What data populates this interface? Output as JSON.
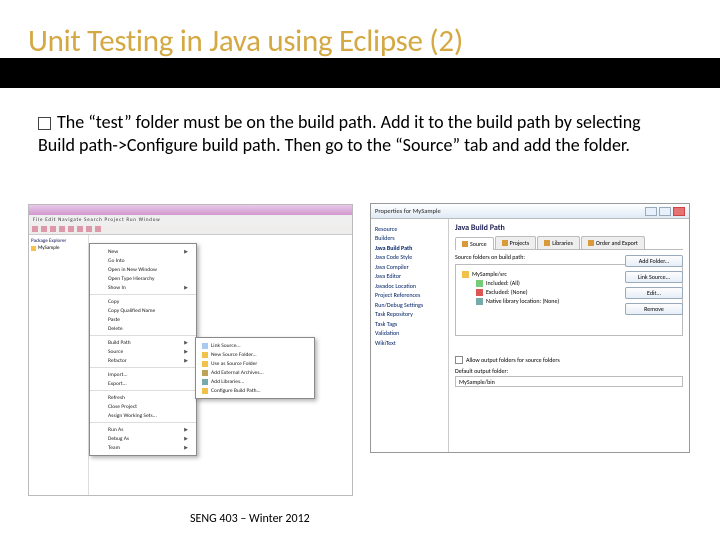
{
  "title": "Unit Testing in Java using Eclipse (2)",
  "body": "The “test” folder must be on the build path. Add it to the build path by selecting Build path->Configure build path. Then go to the “Source” tab and add the folder.",
  "footer": "SENG 403 – Winter 2012",
  "eclipse": {
    "menubar": "File  Edit  Navigate  Search  Project  Run  Window",
    "pkg_explorer_title": "Package Explorer",
    "projects": [
      "MySample"
    ],
    "context_menu": {
      "items": [
        {
          "label": "New",
          "arrow": true
        },
        {
          "label": "Go Into"
        },
        {
          "label": "Open in New Window"
        },
        {
          "label": "Open Type Hierarchy"
        },
        {
          "label": "Show In",
          "arrow": true
        },
        {
          "hr": true
        },
        {
          "label": "Copy"
        },
        {
          "label": "Copy Qualified Name"
        },
        {
          "label": "Paste"
        },
        {
          "label": "Delete"
        },
        {
          "hr": true
        },
        {
          "label": "Build Path",
          "arrow": true
        },
        {
          "label": "Source",
          "arrow": true
        },
        {
          "label": "Refactor",
          "arrow": true
        },
        {
          "hr": true
        },
        {
          "label": "Import..."
        },
        {
          "label": "Export..."
        },
        {
          "hr": true
        },
        {
          "label": "Refresh"
        },
        {
          "label": "Close Project"
        },
        {
          "label": "Assign Working Sets..."
        },
        {
          "hr": true
        },
        {
          "label": "Run As",
          "arrow": true
        },
        {
          "label": "Debug As",
          "arrow": true
        },
        {
          "label": "Team",
          "arrow": true
        }
      ],
      "submenu": [
        {
          "label": "Link Source...",
          "ic": "ic-src"
        },
        {
          "label": "New Source Folder...",
          "ic": "ic-folder"
        },
        {
          "label": "Use as Source Folder",
          "ic": "ic-folder"
        },
        {
          "label": "Add External Archives...",
          "ic": "ic-jar"
        },
        {
          "label": "Add Libraries...",
          "ic": "ic-lib"
        },
        {
          "label": "Configure Build Path...",
          "ic": "ic-folder"
        }
      ]
    }
  },
  "props": {
    "title": "Properties for MySample",
    "nav": [
      "Resource",
      "Builders",
      "Java Build Path",
      "Java Code Style",
      "Java Compiler",
      "Java Editor",
      "Javadoc Location",
      "Project References",
      "Run/Debug Settings",
      "Task Repository",
      "Task Tags",
      "Validation",
      "WikiText"
    ],
    "nav_selected": "Java Build Path",
    "heading": "Java Build Path",
    "tabs": [
      "Source",
      "Projects",
      "Libraries",
      "Order and Export"
    ],
    "active_tab": "Source",
    "tree_label": "Source folders on build path:",
    "tree": {
      "root": "MySample/src",
      "children": [
        {
          "label": "Included: (All)",
          "ic": "ic-green"
        },
        {
          "label": "Excluded: (None)",
          "ic": "ic-red"
        },
        {
          "label": "Native library location: (None)",
          "ic": "ic-lib"
        }
      ]
    },
    "buttons": [
      "Add Folder...",
      "Link Source...",
      "Edit...",
      "Remove"
    ],
    "allow_label": "Allow output folders for source folders",
    "default_label": "Default output folder:",
    "default_value": "MySample/bin"
  }
}
